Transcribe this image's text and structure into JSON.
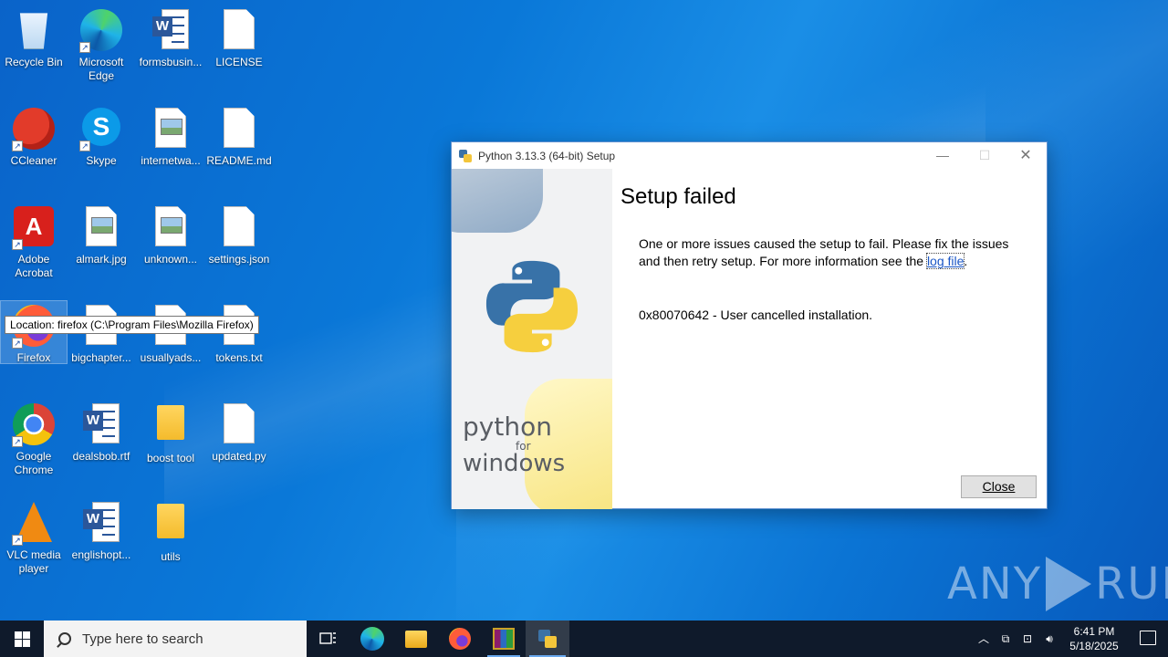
{
  "desktop": {
    "icons": [
      {
        "label": "Recycle Bin"
      },
      {
        "label": "Microsoft Edge"
      },
      {
        "label": "formsbusin..."
      },
      {
        "label": "LICENSE"
      },
      {
        "label": "CCleaner"
      },
      {
        "label": "Skype"
      },
      {
        "label": "internetwa..."
      },
      {
        "label": "README.md"
      },
      {
        "label": "Adobe Acrobat"
      },
      {
        "label": "almark.jpg"
      },
      {
        "label": "unknown..."
      },
      {
        "label": "settings.json"
      },
      {
        "label": "Firefox"
      },
      {
        "label": "bigchapter..."
      },
      {
        "label": "usuallyads..."
      },
      {
        "label": "tokens.txt"
      },
      {
        "label": "Google Chrome"
      },
      {
        "label": "dealsbob.rtf"
      },
      {
        "label": "boost tool"
      },
      {
        "label": "updated.py"
      },
      {
        "label": "VLC media player"
      },
      {
        "label": "englishopt..."
      },
      {
        "label": "utils"
      }
    ],
    "tooltip": "Location: firefox (C:\\Program Files\\Mozilla Firefox)"
  },
  "dialog": {
    "title": "Python 3.13.3 (64-bit) Setup",
    "heading": "Setup failed",
    "message_before_link": "One or more issues caused the setup to fail. Please fix the issues and then retry setup. For more information see the ",
    "link_text": "log file",
    "message_after_link": ".",
    "error": "0x80070642 - User cancelled installation.",
    "close_button": "Close",
    "side_text": {
      "line1": "python",
      "line2": "for",
      "line3": "windows"
    }
  },
  "watermark": {
    "left": "ANY",
    "right": "RUN"
  },
  "taskbar": {
    "search_placeholder": "Type here to search",
    "apps": [
      "task-view",
      "microsoft-edge",
      "file-explorer",
      "firefox",
      "winrar",
      "python-setup"
    ],
    "time": "6:41 PM",
    "date": "5/18/2025"
  },
  "colors": {
    "accent": "#0078d7",
    "taskbar": "#0f1a2b",
    "link": "#1a56c6"
  }
}
